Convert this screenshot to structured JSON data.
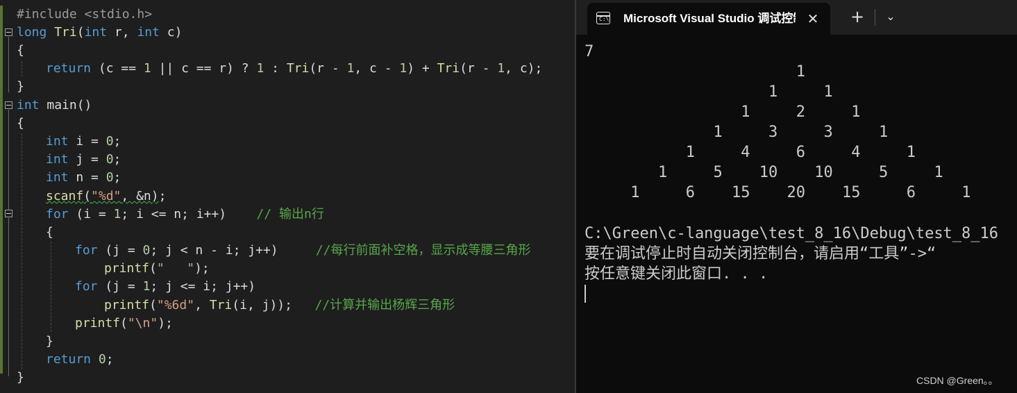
{
  "editor": {
    "lines": {
      "l1": "#include <stdio.h>",
      "l2a": "long",
      "l2b": "Tri",
      "l2c": "(",
      "l2d": "int",
      "l2e": " r, ",
      "l2f": "int",
      "l2g": " c)",
      "l3": "{",
      "l4a": "return",
      "l4b": " (c == ",
      "l4c": "1",
      "l4d": " || c == r) ? ",
      "l4e": "1",
      "l4f": " : ",
      "l4g": "Tri",
      "l4h": "(r - ",
      "l4i": "1",
      "l4j": ", c - ",
      "l4k": "1",
      "l4l": ") + ",
      "l4m": "Tri",
      "l4n": "(r - ",
      "l4o": "1",
      "l4p": ", c);",
      "l5": "}",
      "l6a": "int",
      "l6b": " main()",
      "l7": "{",
      "l8a": "int",
      "l8b": " i = ",
      "l8c": "0",
      "l8d": ";",
      "l9a": "int",
      "l9b": " j = ",
      "l9c": "0",
      "l9d": ";",
      "l10a": "int",
      "l10b": " n = ",
      "l10c": "0",
      "l10d": ";",
      "l11a": "scanf",
      "l11b": "(",
      "l11c": "\"%d\"",
      "l11d": ", &n)",
      "l11e": ";",
      "l12a": "for",
      "l12b": " (i = ",
      "l12c": "1",
      "l12d": "; i <= n; i++)    ",
      "l12e": "// 输出n行",
      "l13": "{",
      "l14a": "for",
      "l14b": " (j = ",
      "l14c": "0",
      "l14d": "; j < n - i; j++)     ",
      "l14e": "//每行前面补空格，显示成等腰三角形",
      "l15a": "printf",
      "l15b": "(",
      "l15c": "\"   \"",
      "l15d": ");",
      "l16a": "for",
      "l16b": " (j = ",
      "l16c": "1",
      "l16d": "; j <= i; j++)",
      "l17a": "printf",
      "l17b": "(",
      "l17c": "\"%6d\"",
      "l17d": ", ",
      "l17e": "Tri",
      "l17f": "(i, j));   ",
      "l17g": "//计算并输出杨辉三角形",
      "l18a": "printf",
      "l18b": "(",
      "l18c": "\"\\n\"",
      "l18d": ");",
      "l19": "}",
      "l20a": "return",
      "l20b": " ",
      "l20c": "0",
      "l20d": ";",
      "l21": "}"
    }
  },
  "terminal": {
    "tab_title": "Microsoft Visual Studio 调试控制台",
    "tab_close": "✕",
    "new_tab": "+",
    "dropdown": "⌄",
    "icon_text": "C:\\",
    "input_value": "7",
    "triangle": [
      [
        "1"
      ],
      [
        "1",
        "1"
      ],
      [
        "1",
        "2",
        "1"
      ],
      [
        "1",
        "3",
        "3",
        "1"
      ],
      [
        "1",
        "4",
        "6",
        "4",
        "1"
      ],
      [
        "1",
        "5",
        "10",
        "10",
        "5",
        "1"
      ],
      [
        "1",
        "6",
        "15",
        "20",
        "15",
        "6",
        "1"
      ]
    ],
    "exit_path": "C:\\Green\\c-language\\test_8_16\\Debug\\test_8_16",
    "note_line1": "要在调试停止时自动关闭控制台，请启用“工具”->“",
    "note_line2": "按任意键关闭此窗口. . ."
  },
  "watermark": "CSDN @Green。。"
}
